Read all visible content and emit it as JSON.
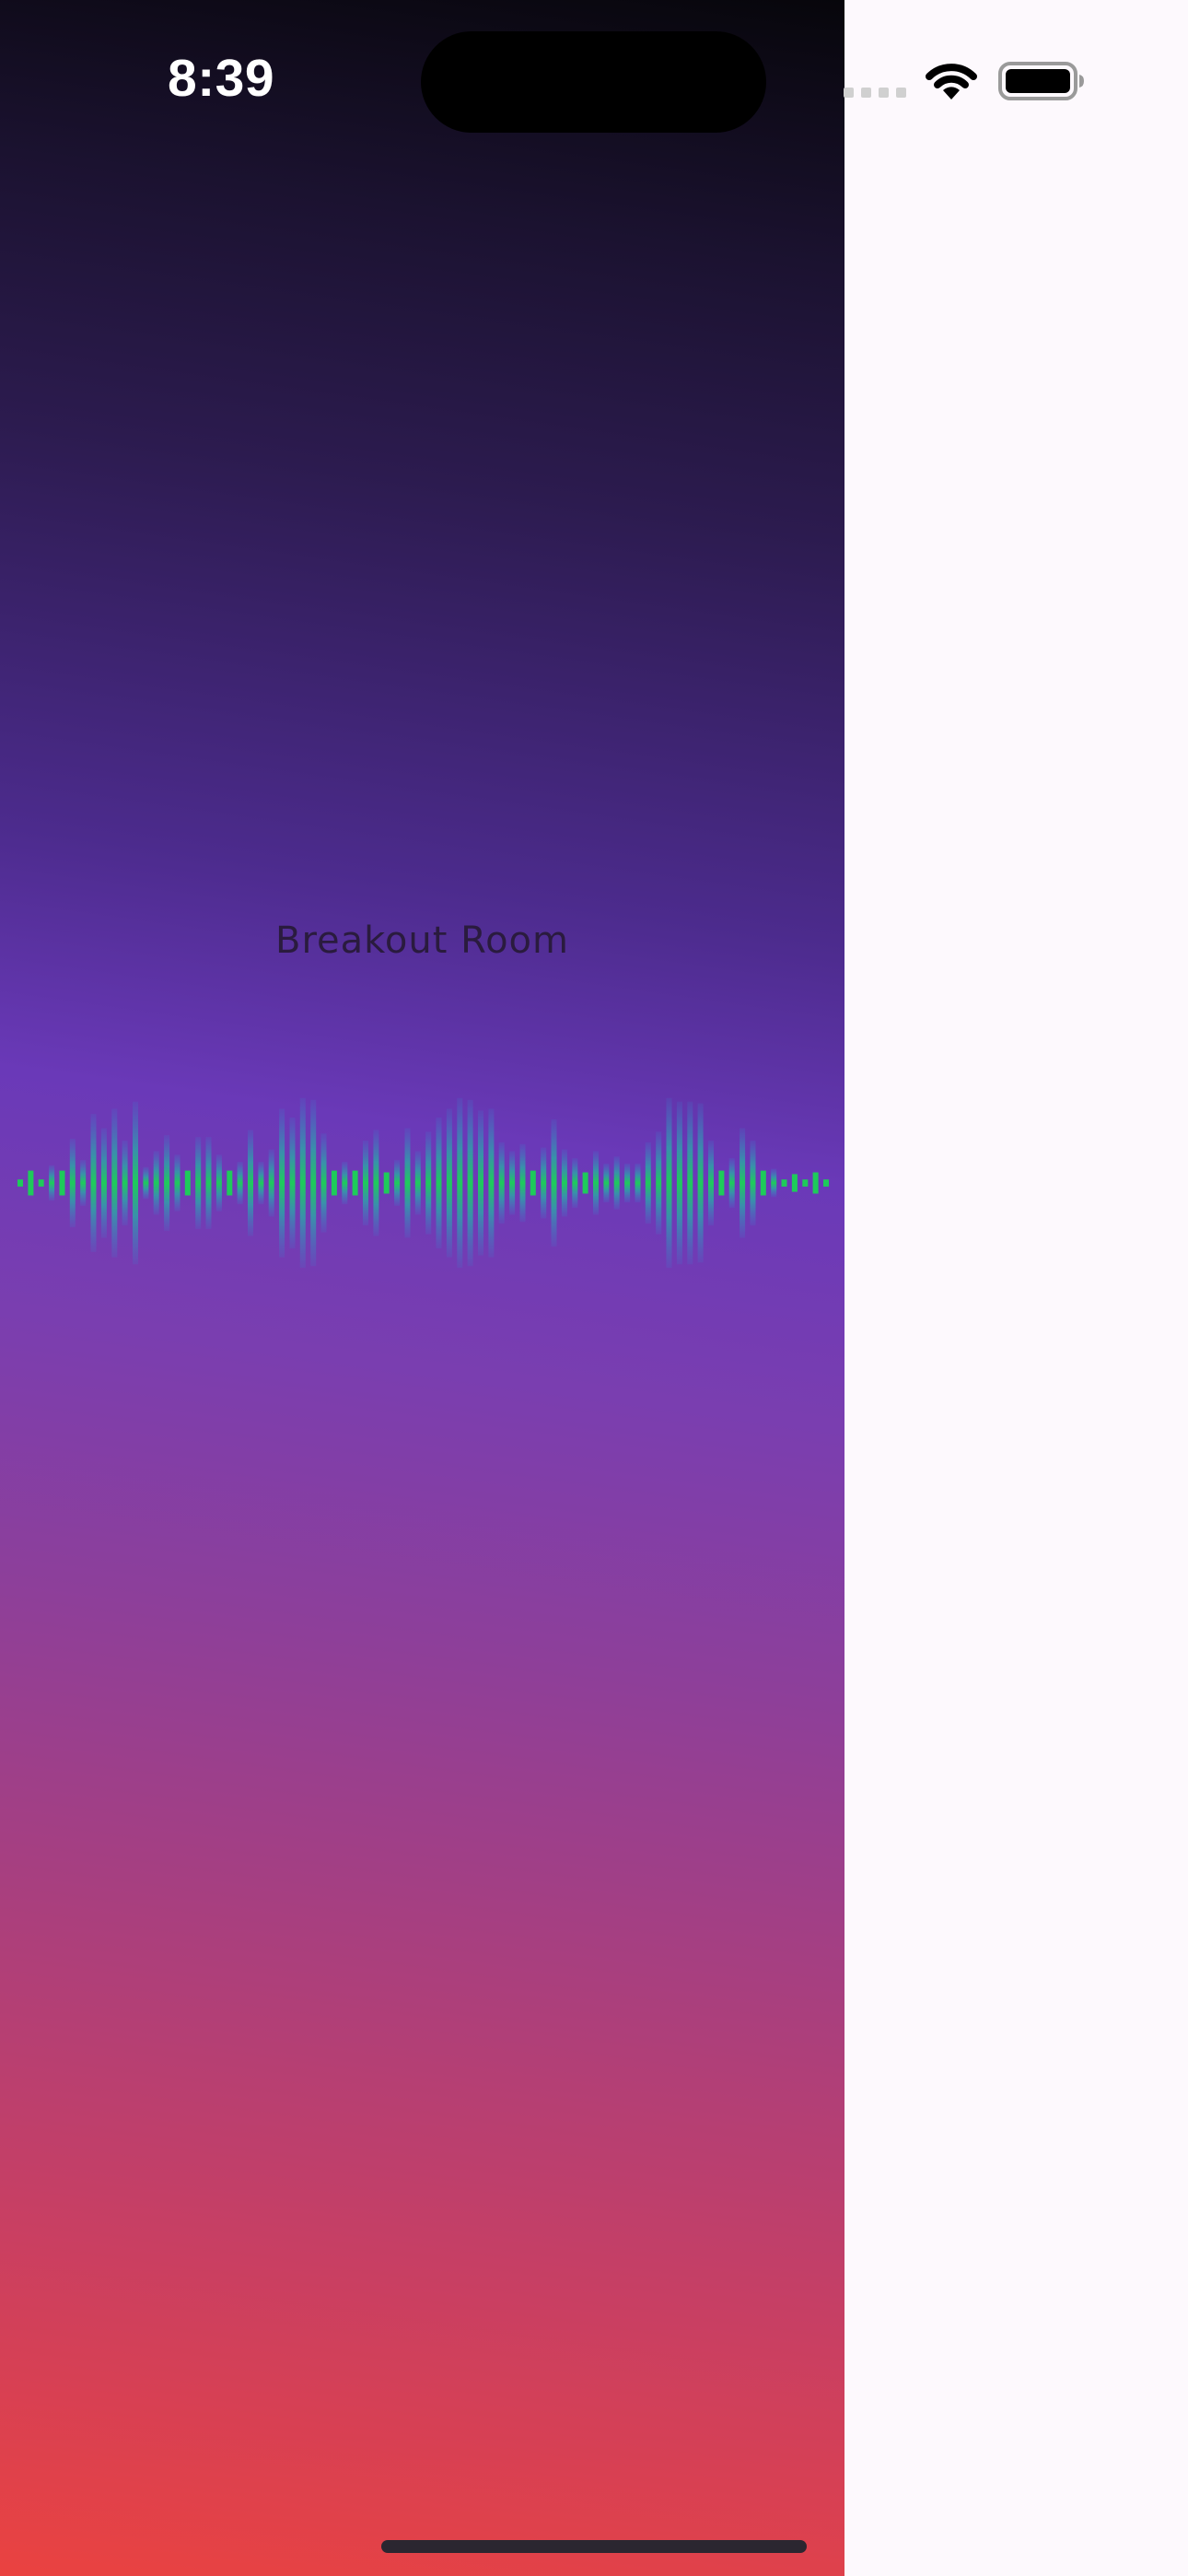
{
  "status_bar": {
    "time": "8:39",
    "icons": [
      "cellular-signal-icon",
      "wifi-icon",
      "battery-icon"
    ]
  },
  "room": {
    "title": "Breakout Room"
  },
  "waveform": {
    "icon": "audio-waveform",
    "bar_color": "#1ecb5a",
    "levels": [
      0.04,
      0.14,
      0.04,
      0.2,
      0.14,
      0.5,
      0.26,
      0.78,
      0.62,
      0.84,
      0.48,
      0.92,
      0.18,
      0.36,
      0.54,
      0.32,
      0.14,
      0.52,
      0.52,
      0.32,
      0.14,
      0.24,
      0.6,
      0.24,
      0.38,
      0.84,
      0.74,
      0.96,
      0.94,
      0.56,
      0.14,
      0.24,
      0.14,
      0.48,
      0.6,
      0.12,
      0.26,
      0.62,
      0.36,
      0.58,
      0.74,
      0.84,
      0.96,
      0.94,
      0.82,
      0.84,
      0.46,
      0.36,
      0.44,
      0.14,
      0.4,
      0.72,
      0.38,
      0.28,
      0.12,
      0.36,
      0.22,
      0.3,
      0.22,
      0.22,
      0.46,
      0.58,
      0.96,
      0.92,
      0.92,
      0.9,
      0.48,
      0.14,
      0.28,
      0.62,
      0.48,
      0.14,
      0.16,
      0.04,
      0.1,
      0.04,
      0.12,
      0.04
    ]
  },
  "colors": {
    "gradient_top": "#07060b",
    "gradient_mid": "#6a39b8",
    "gradient_bottom": "#ea4240",
    "side_background": "#fdf9fd"
  }
}
